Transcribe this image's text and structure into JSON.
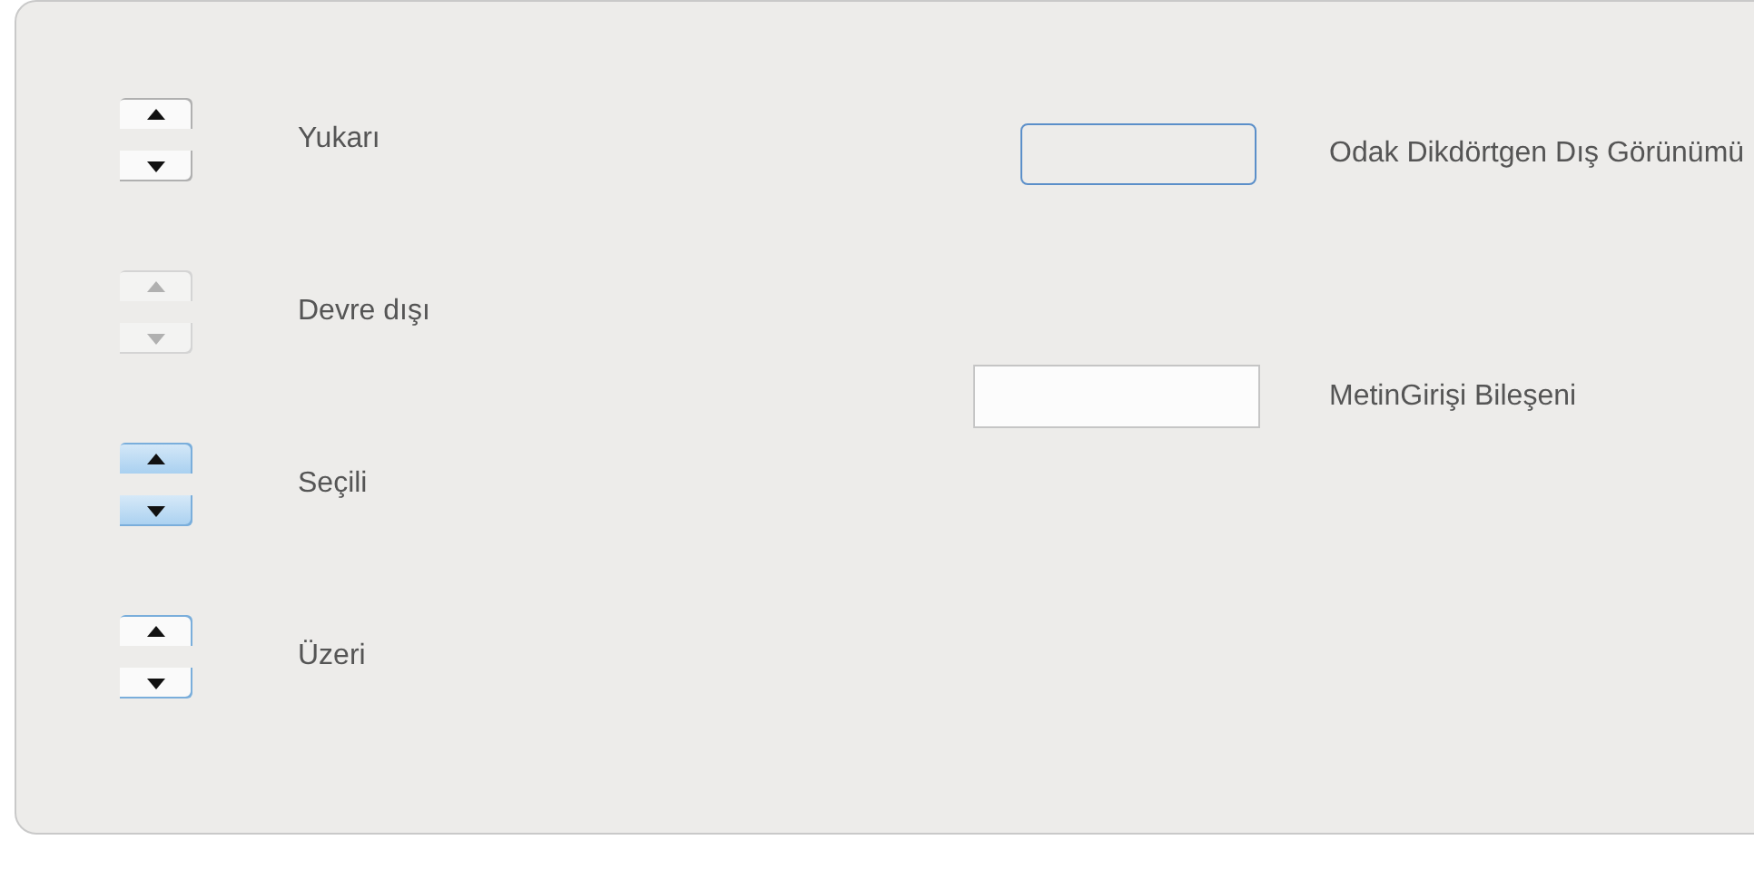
{
  "spinners": [
    {
      "kind": "normal",
      "label": "Yukarı"
    },
    {
      "kind": "disabled",
      "label": "Devre dışı"
    },
    {
      "kind": "selected",
      "label": "Seçili"
    },
    {
      "kind": "hover",
      "label": "Üzeri"
    }
  ],
  "focus_rectangle": {
    "label": "Odak Dikdörtgen Dış Görünümü"
  },
  "text_input": {
    "label": "MetinGirişi Bileşeni"
  }
}
